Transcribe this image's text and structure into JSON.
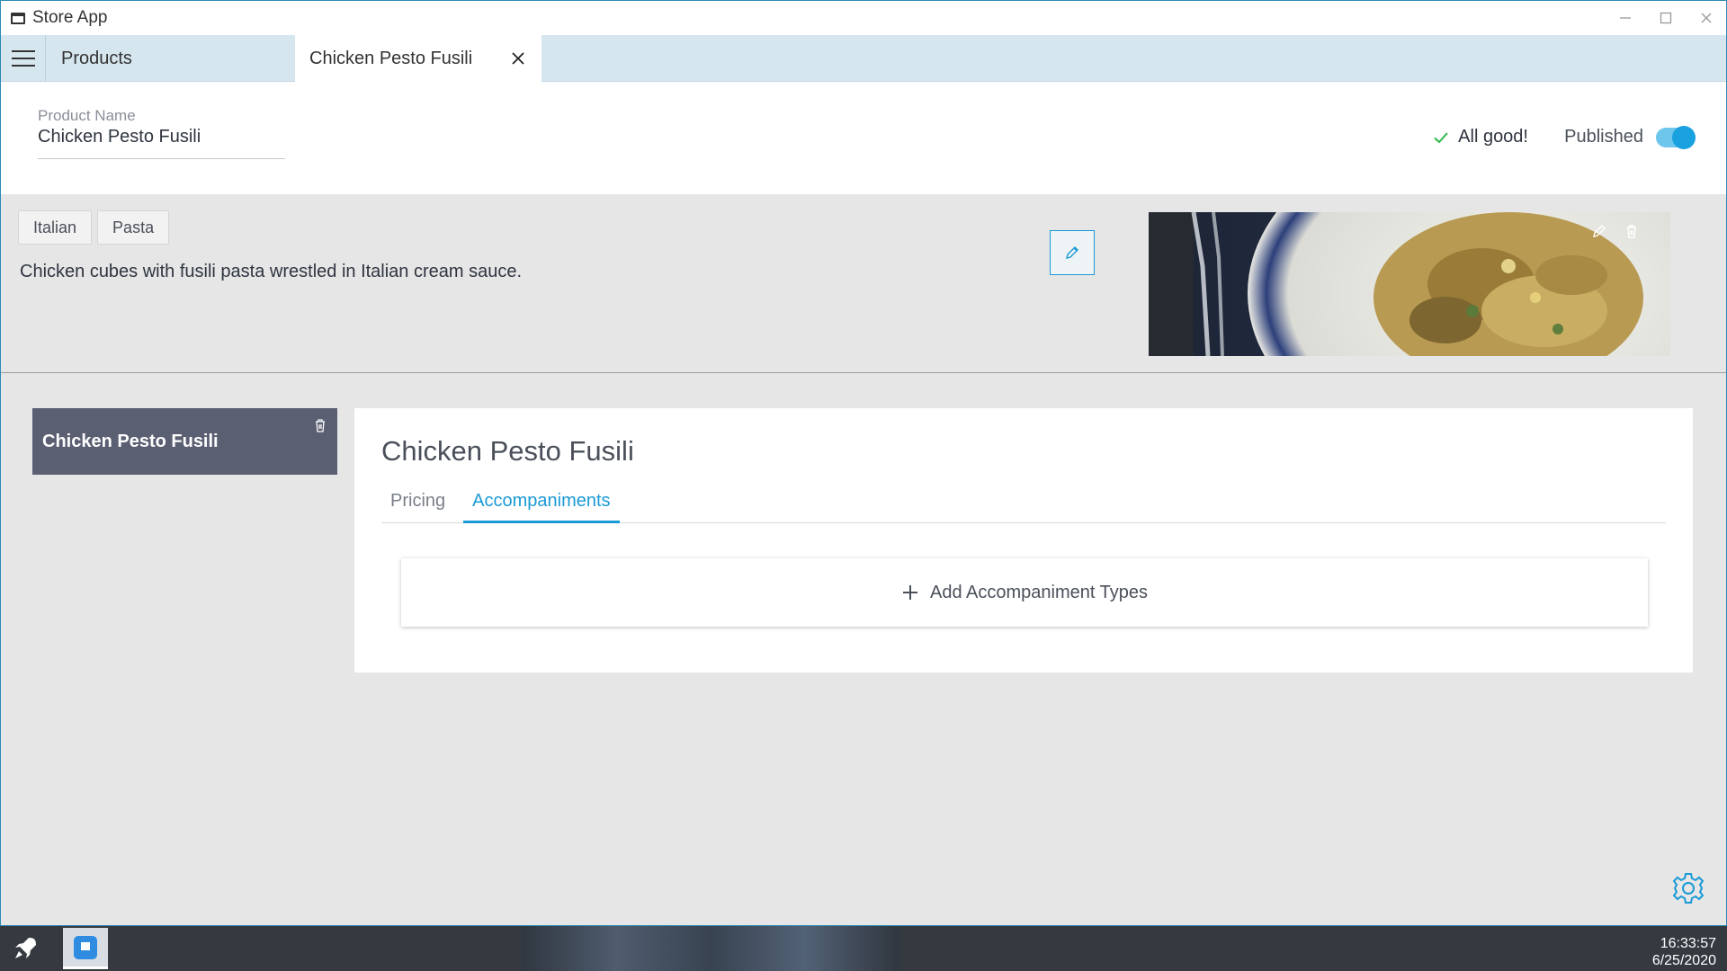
{
  "window": {
    "title": "Store App"
  },
  "tabs": {
    "products_label": "Products",
    "active_label": "Chicken Pesto Fusili"
  },
  "product": {
    "name_label": "Product Name",
    "name_value": "Chicken Pesto Fusili",
    "status_text": "All good!",
    "published_label": "Published",
    "published": true,
    "tags": [
      "Italian",
      "Pasta"
    ],
    "description": "Chicken cubes with fusili pasta wrestled in Italian cream sauce."
  },
  "variant": {
    "name": "Chicken Pesto Fusili"
  },
  "detail": {
    "title": "Chicken Pesto Fusili",
    "tabs": [
      "Pricing",
      "Accompaniments"
    ],
    "active_tab": "Accompaniments",
    "add_label": "Add Accompaniment Types"
  },
  "taskbar": {
    "time": "16:33:57",
    "date": "6/25/2020"
  },
  "colors": {
    "accent": "#1a9ad6",
    "variant_bg": "#5a5f72",
    "tabbar_bg": "#d6e6ef",
    "check": "#2db84a"
  },
  "icons": [
    "app-window-icon",
    "minimize-icon",
    "maximize-icon",
    "close-icon",
    "hamburger-icon",
    "tab-close-icon",
    "checkmark-icon",
    "pencil-icon",
    "trash-icon",
    "plus-icon",
    "gear-icon",
    "rocket-icon",
    "store-app-icon"
  ]
}
